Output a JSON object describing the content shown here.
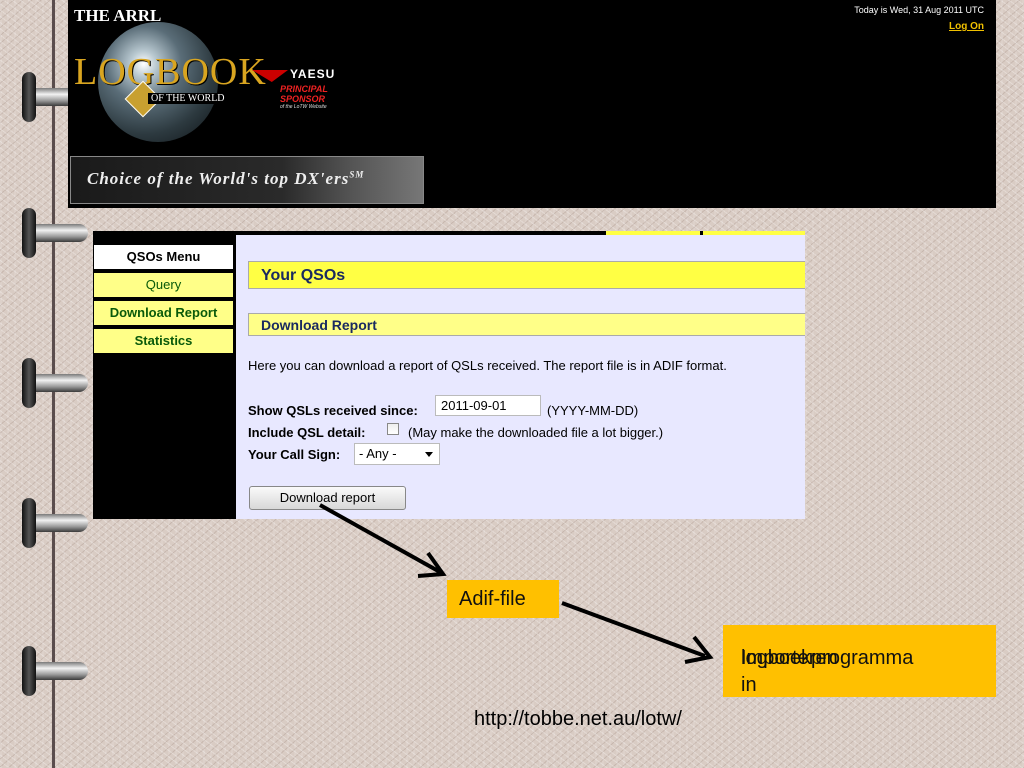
{
  "banner": {
    "org": "THE ARRL",
    "logo_main": "LOGBOOK",
    "logo_sub": "OF THE WORLD",
    "sponsor_brand": "YAESU",
    "sponsor_title": "PRINCIPAL SPONSOR",
    "sponsor_sub": "of the LoTW Website",
    "date": "Today is Wed, 31 Aug 2011 UTC",
    "log_on": "Log On",
    "tagline": "Choice of the World's top DX'ers",
    "tagline_mark": "SM"
  },
  "sidebar": {
    "title": "QSOs Menu",
    "items": [
      {
        "label": "Query"
      },
      {
        "label": "Download Report"
      },
      {
        "label": "Statistics"
      }
    ]
  },
  "main": {
    "heading": "Your QSOs",
    "section": "Download Report",
    "description": "Here you can download a report of QSLs received. The report file is in ADIF format.",
    "since_label": "Show QSLs received since:",
    "since_value": "2011-09-01",
    "since_hint": "(YYYY-MM-DD)",
    "detail_label": "Include QSL detail:",
    "detail_checked": false,
    "detail_hint": "(May make the downloaded file a lot bigger.)",
    "callsign_label": "Your Call Sign:",
    "callsign_value": "- Any -",
    "download_button": "Download report"
  },
  "annotations": {
    "adif_label": "Adif-file",
    "import_label_line1": "Importeren in",
    "import_label_line2": "logboekprogramma",
    "source_url": "http://tobbe.net.au/lotw/",
    "callout_color": "#ffc000"
  }
}
